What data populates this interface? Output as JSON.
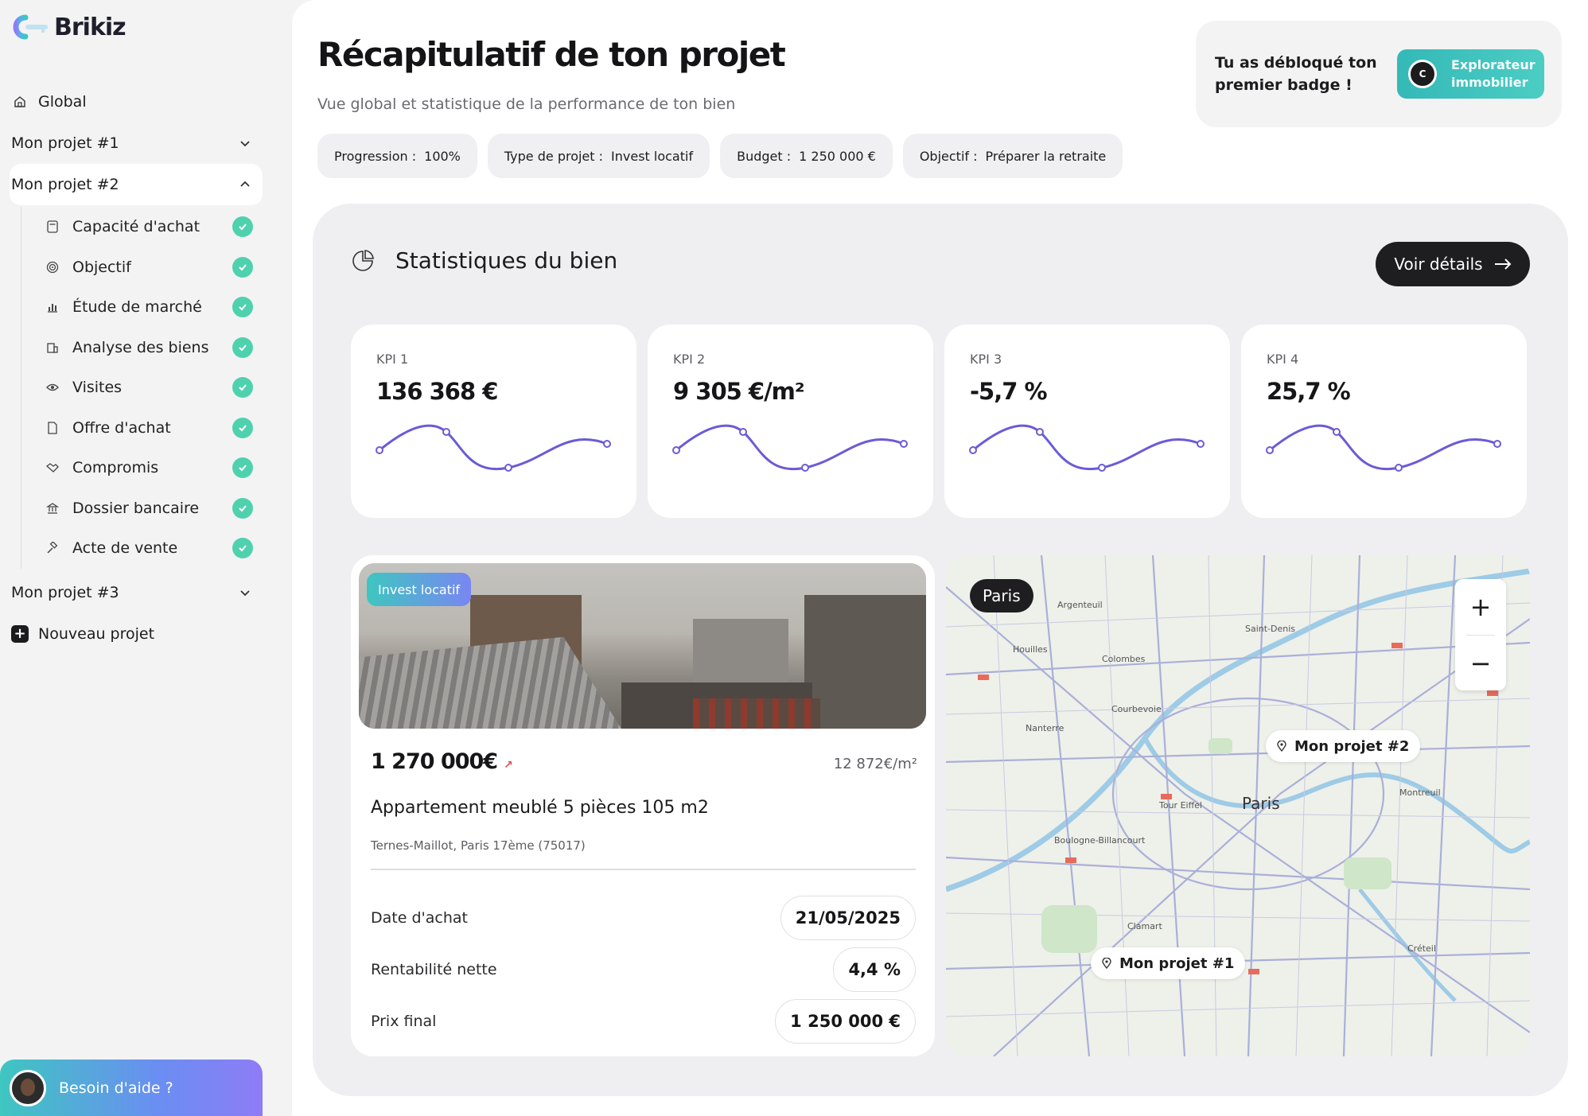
{
  "app": {
    "name": "Brikiz"
  },
  "sidebar": {
    "global_label": "Global",
    "projects": [
      {
        "label": "Mon projet #1"
      },
      {
        "label": "Mon projet #2"
      },
      {
        "label": "Mon projet #3"
      }
    ],
    "steps": [
      {
        "label": "Capacité d'achat",
        "icon": "calculator-icon"
      },
      {
        "label": "Objectif",
        "icon": "target-icon"
      },
      {
        "label": "Étude de marché",
        "icon": "chart-icon"
      },
      {
        "label": "Analyse des biens",
        "icon": "building-icon"
      },
      {
        "label": "Visites",
        "icon": "eye-icon"
      },
      {
        "label": "Offre d'achat",
        "icon": "document-icon"
      },
      {
        "label": "Compromis",
        "icon": "handshake-icon"
      },
      {
        "label": "Dossier bancaire",
        "icon": "bank-icon"
      },
      {
        "label": "Acte de vente",
        "icon": "gavel-icon"
      }
    ],
    "new_project_label": "Nouveau projet",
    "help_label": "Besoin d'aide ?"
  },
  "header": {
    "title": "Récapitulatif de ton projet",
    "subtitle": "Vue global et statistique de la performance de ton bien",
    "chips": [
      {
        "key": "Progression :",
        "value": "100%"
      },
      {
        "key": "Type de projet :",
        "value": "Invest locatif"
      },
      {
        "key": "Budget :",
        "value": "1 250 000 €"
      },
      {
        "key": "Objectif :",
        "value": "Préparer la retraite"
      }
    ]
  },
  "badge": {
    "text": "Tu as débloqué ton premier badge !",
    "name_line1": "Explorateur",
    "name_line2": "immobilier"
  },
  "stats": {
    "title": "Statistiques du bien",
    "details_button": "Voir détails",
    "kpis": [
      {
        "label": "KPI 1",
        "value": "136 368 €"
      },
      {
        "label": "KPI 2",
        "value": "9 305 €/m²"
      },
      {
        "label": "KPI 3",
        "value": "-5,7 %"
      },
      {
        "label": "KPI 4",
        "value": "25,7 %"
      }
    ]
  },
  "property": {
    "tag": "Invest locatif",
    "price": "1 270 000€",
    "price_per_m2": "12 872€/m²",
    "name": "Appartement meublé 5 pièces 105 m2",
    "address": "Ternes-Maillot, Paris 17ème (75017)",
    "details": [
      {
        "label": "Date d'achat",
        "value": "21/05/2025"
      },
      {
        "label": "Rentabilité nette",
        "value": "4,4 %"
      },
      {
        "label": "Prix final",
        "value": "1 250 000 €"
      }
    ]
  },
  "map": {
    "city": "Paris",
    "pins": [
      "Mon projet #2",
      "Mon projet #1"
    ],
    "labels": [
      "Argenteuil",
      "Saint-Denis",
      "Nanterre",
      "Paris",
      "Boulogne-Billancourt",
      "Tour Eiffel",
      "Houilles",
      "Colombes",
      "Courbevoie",
      "Créteil",
      "Montreuil",
      "Clamart"
    ]
  },
  "colors": {
    "accent": "#4fd1ae",
    "line": "#6b5bd6",
    "dark": "#1e1e20"
  }
}
